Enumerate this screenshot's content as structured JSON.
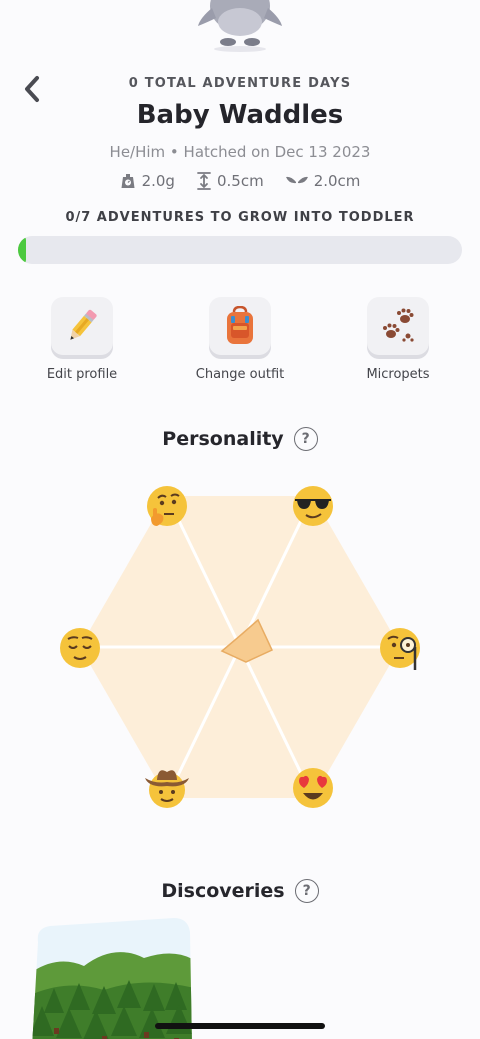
{
  "header": {
    "total_adventure_days": "0 TOTAL ADVENTURE DAYS",
    "pet_name": "Baby Waddles",
    "pet_subtitle": "He/Him • Hatched on Dec 13 2023",
    "stats": {
      "weight": "2.0g",
      "height": "0.5cm",
      "wingspan": "2.0cm"
    }
  },
  "growth": {
    "label": "0/7 ADVENTURES TO GROW INTO TODDLER",
    "progress": 0.0,
    "fill_color": "#4cc93f"
  },
  "actions": [
    {
      "label": "Edit profile",
      "icon": "pencil-icon"
    },
    {
      "label": "Change outfit",
      "icon": "backpack-icon"
    },
    {
      "label": "Micropets",
      "icon": "paw-prints-icon"
    }
  ],
  "personality": {
    "title": "Personality",
    "help": "?",
    "traits": [
      "thinking-face-icon",
      "cool-sunglasses-face-icon",
      "curious-monocle-face-icon",
      "heart-eyes-face-icon",
      "cowboy-face-icon",
      "relieved-face-icon"
    ]
  },
  "discoveries": {
    "title": "Discoveries",
    "help": "?"
  },
  "colors": {
    "hexagon_fill": "#fdeed9",
    "shape_fill": "#f7cb8f",
    "accent_green": "#4cc93f"
  }
}
